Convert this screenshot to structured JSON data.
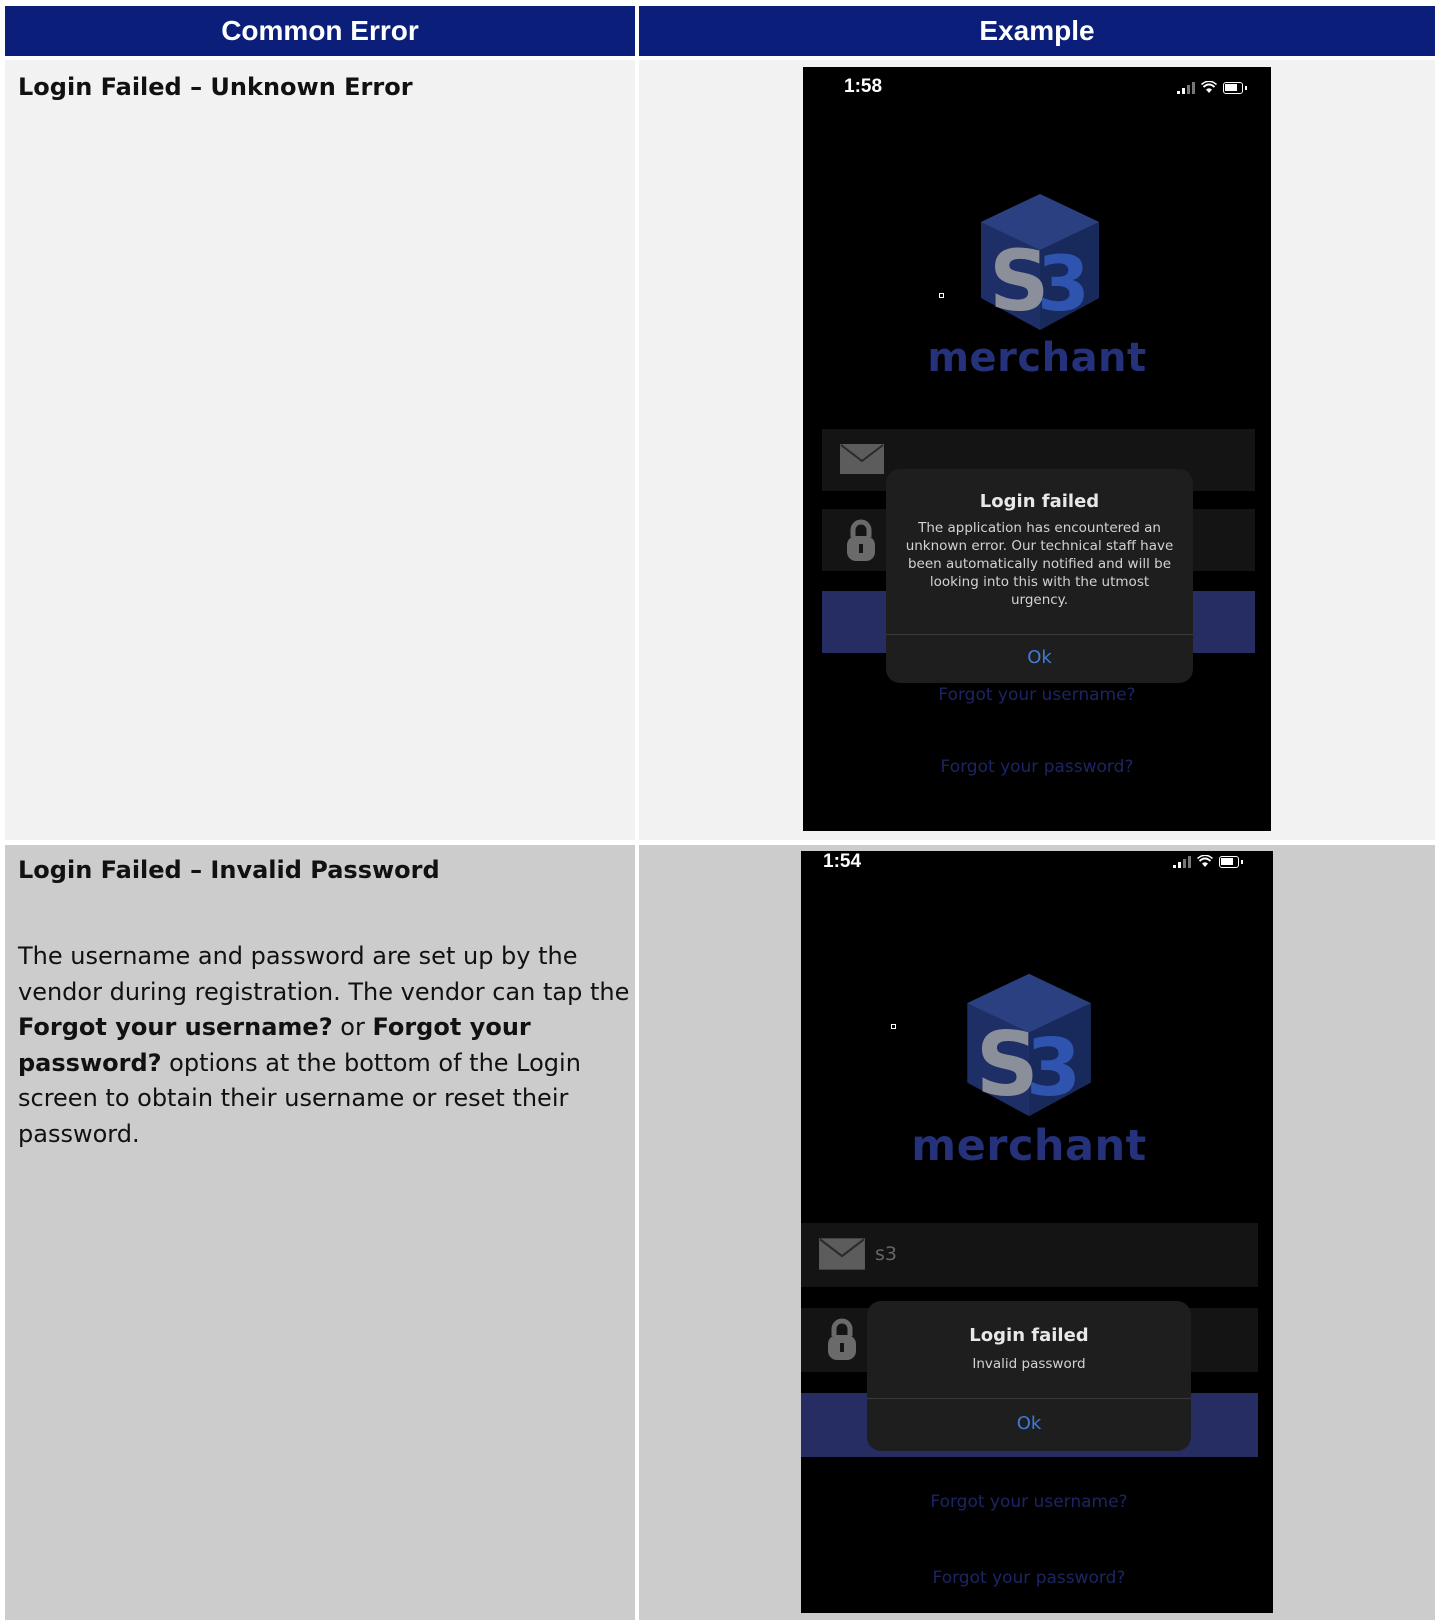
{
  "table": {
    "headers": [
      "Common Error",
      "Example"
    ]
  },
  "rows": [
    {
      "title": "Login Failed – Unknown Error",
      "phone": {
        "time": "1:58",
        "brand": "merchant",
        "username_value": "",
        "alert": {
          "title": "Login failed",
          "message": "The application has encountered an unknown error. Our technical staff have been automatically notified and will be looking into this with the utmost urgency.",
          "button": "Ok"
        },
        "forgot_username": "Forgot your username?",
        "forgot_password": "Forgot your password?"
      }
    },
    {
      "title": "Login Failed – Invalid Password",
      "description": {
        "part1": "The username and password are set up by the vendor during registration. The vendor can tap the ",
        "bold1": "Forgot your username?",
        "part2": " or ",
        "bold2": "Forgot your password?",
        "part3": " options at the bottom of the Login screen to obtain their username or reset their password."
      },
      "phone": {
        "time": "1:54",
        "brand": "merchant",
        "username_value": "s3",
        "alert": {
          "title": "Login failed",
          "message": "Invalid password",
          "button": "Ok"
        },
        "forgot_username": "Forgot your username?",
        "forgot_password": "Forgot your password?"
      }
    }
  ],
  "colors": {
    "header_bg": "#0b1f7a",
    "row1_bg": "#f2f2f2",
    "row2_bg": "#cccccc",
    "alert_button": "#3f7bd9"
  }
}
